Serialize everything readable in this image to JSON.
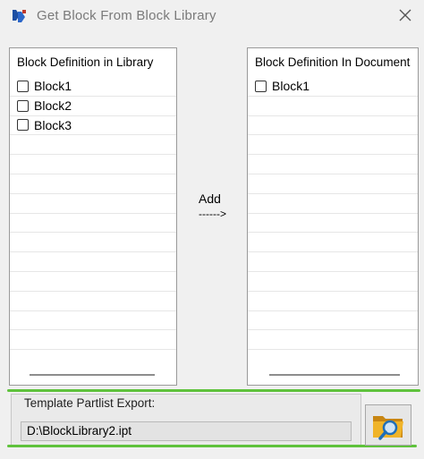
{
  "window": {
    "title": "Get Block From Block Library",
    "app_icon": "block-library-icon",
    "close_icon": "close-icon"
  },
  "library_panel": {
    "header": "Block Definition in Library",
    "items": [
      {
        "label": "Block1",
        "checked": false
      },
      {
        "label": "Block2",
        "checked": false
      },
      {
        "label": "Block3",
        "checked": false
      }
    ]
  },
  "document_panel": {
    "header": "Block Definition In Document",
    "items": [
      {
        "label": "Block1",
        "checked": false
      }
    ]
  },
  "transfer": {
    "add_label": "Add",
    "arrow": "------>"
  },
  "export": {
    "group_label": "Template Partlist Export:",
    "path_value": "D:\\BlockLibrary2.ipt",
    "browse_icon": "folder-search-icon"
  },
  "colors": {
    "highlight": "#5fc23c",
    "folder": "#e8a521",
    "magnifier": "#1f6fb8"
  }
}
